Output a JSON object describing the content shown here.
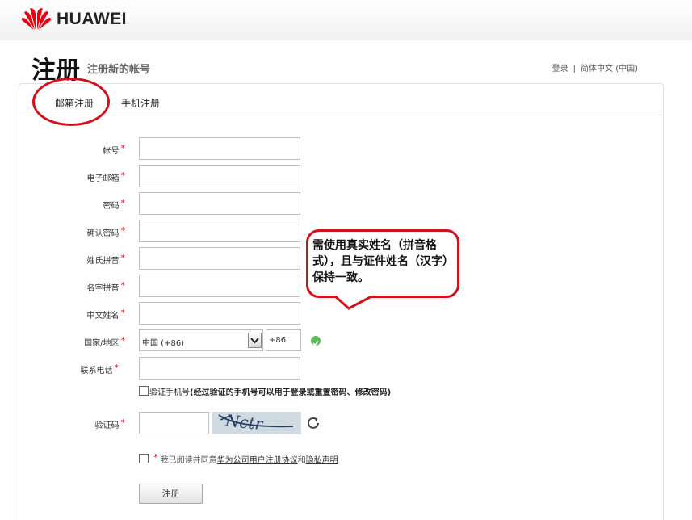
{
  "header": {
    "logo_text": "HUAWEI"
  },
  "page": {
    "title": "注册",
    "subtitle": "注册新的帐号"
  },
  "top_links": {
    "login": "登录",
    "separator": "|",
    "language": "简体中文 (中国)"
  },
  "tabs": [
    {
      "label": "邮箱注册",
      "active": true
    },
    {
      "label": "手机注册",
      "active": false
    }
  ],
  "form": {
    "required_mark": "*",
    "fields": [
      {
        "label": "帐号",
        "value": ""
      },
      {
        "label": "电子邮箱",
        "value": ""
      },
      {
        "label": "密码",
        "value": ""
      },
      {
        "label": "确认密码",
        "value": ""
      },
      {
        "label": "姓氏拼音",
        "value": ""
      },
      {
        "label": "名字拼音",
        "value": ""
      },
      {
        "label": "中文姓名",
        "value": ""
      },
      {
        "label": "国家/地区"
      },
      {
        "label": "联系电话",
        "value": ""
      }
    ],
    "country_select": "中国 (+86)",
    "country_code": "+86",
    "verify_phone": {
      "prefix": "验证手机号",
      "note": "(经过验证的手机号可以用于登录或重置密码、修改密码)"
    },
    "captcha": {
      "label": "验证码",
      "image_text": "Nctr"
    },
    "agree": {
      "text": "我已阅读并同意",
      "link1": "华为公司用户注册协议",
      "and": "和",
      "link2": "隐私声明"
    },
    "submit_label": "注册"
  },
  "callout": {
    "text": "需使用真实姓名（拼音格式），且与证件姓名（汉字）保持一致。"
  },
  "colors": {
    "accent_red": "#d0121c",
    "ok_green": "#5cb85c"
  }
}
